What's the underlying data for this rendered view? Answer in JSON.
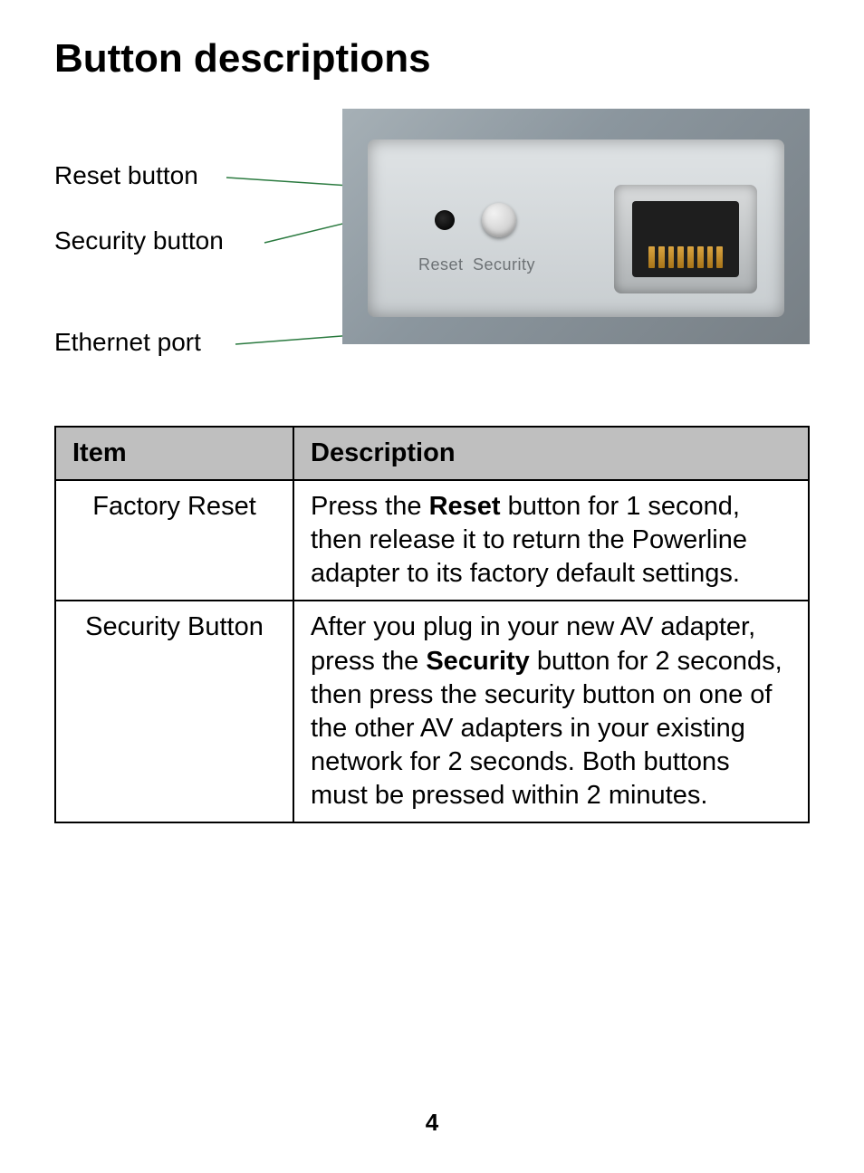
{
  "title": "Button descriptions",
  "callouts": {
    "reset": "Reset button",
    "security": "Security button",
    "ethernet": "Ethernet port"
  },
  "photo_labels": {
    "reset": "Reset",
    "security": "Security"
  },
  "table": {
    "headers": {
      "item": "Item",
      "description": "Description"
    },
    "rows": [
      {
        "item": "Factory Reset",
        "desc_pre": "Press the ",
        "desc_bold": "Reset",
        "desc_post": " button for 1 second, then release it to return the Powerline adapter to its factory default settings."
      },
      {
        "item": "Security Button",
        "desc_pre": "After you plug in your new AV adapter, press the ",
        "desc_bold": "Security",
        "desc_post": " button for 2 seconds, then press the security button on one of the other AV adapters in your existing network for 2 seconds. Both buttons must be pressed within 2 minutes."
      }
    ]
  },
  "page_number": "4"
}
